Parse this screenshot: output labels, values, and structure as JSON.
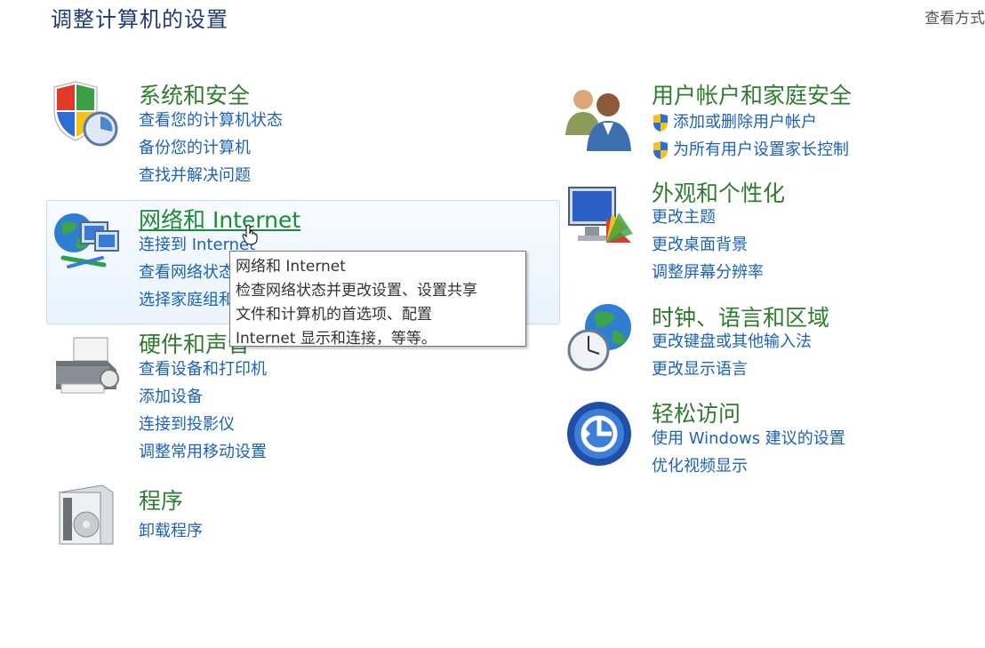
{
  "header": {
    "title": "调整计算机的设置",
    "view_by_label": "查看方式"
  },
  "categories": {
    "system": {
      "title": "系统和安全",
      "icon": "shield-clock-icon",
      "links": [
        "查看您的计算机状态",
        "备份您的计算机",
        "查找并解决问题"
      ]
    },
    "network": {
      "title": "网络和 Internet",
      "icon": "globe-network-icon",
      "links": [
        "连接到 Internet",
        "查看网络状态和任务",
        "选择家庭组和共享选项"
      ]
    },
    "hardware": {
      "title": "硬件和声音",
      "icon": "printer-icon",
      "links": [
        "查看设备和打印机",
        "添加设备",
        "连接到投影仪",
        "调整常用移动设置"
      ]
    },
    "programs": {
      "title": "程序",
      "icon": "programs-box-icon",
      "links": [
        "卸载程序"
      ]
    },
    "users": {
      "title": "用户帐户和家庭安全",
      "icon": "users-icon",
      "links": [
        "添加或删除用户帐户",
        "为所有用户设置家长控制"
      ]
    },
    "appearance": {
      "title": "外观和个性化",
      "icon": "monitor-palette-icon",
      "links": [
        "更改主题",
        "更改桌面背景",
        "调整屏幕分辨率"
      ]
    },
    "clock": {
      "title": "时钟、语言和区域",
      "icon": "clock-globe-icon",
      "links": [
        "更改键盘或其他输入法",
        "更改显示语言"
      ]
    },
    "ease": {
      "title": "轻松访问",
      "icon": "ease-of-access-icon",
      "links": [
        "使用 Windows 建议的设置",
        "优化视频显示"
      ]
    }
  },
  "tooltip": {
    "lines": [
      "网络和 Internet",
      "检查网络状态并更改设置、设置共享",
      "文件和计算机的首选项、配置",
      "Internet 显示和连接，等等。"
    ]
  },
  "colors": {
    "category_title": "#2e7d2e",
    "link": "#1c62b9",
    "page_title": "#1e3a78"
  }
}
